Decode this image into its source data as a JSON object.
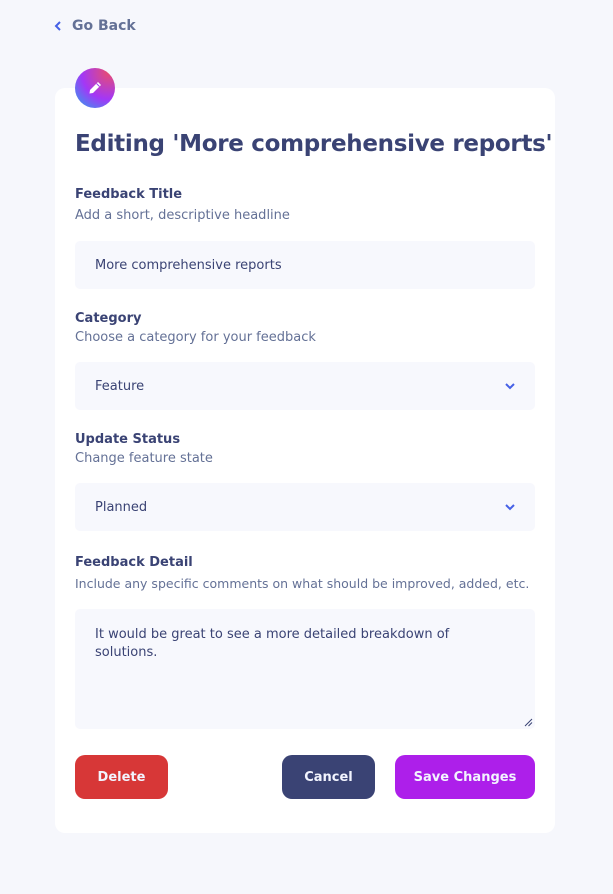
{
  "nav": {
    "go_back_label": "Go Back"
  },
  "page": {
    "title": "Editing 'More comprehensive reports'"
  },
  "form": {
    "feedback_title": {
      "label": "Feedback Title",
      "hint": "Add a short, descriptive headline",
      "value": "More comprehensive reports"
    },
    "category": {
      "label": "Category",
      "hint": "Choose a category for your feedback",
      "value": "Feature"
    },
    "status": {
      "label": "Update Status",
      "hint": "Change feature state",
      "value": "Planned"
    },
    "detail": {
      "label": "Feedback Detail",
      "hint": "Include any specific comments on what should be improved, added, etc.",
      "value": "It would be great to see a more detailed breakdown of solutions."
    }
  },
  "actions": {
    "delete_label": "Delete",
    "cancel_label": "Cancel",
    "save_label": "Save Changes"
  },
  "colors": {
    "delete": "#d73737",
    "cancel": "#3a4374",
    "save": "#ad1fea",
    "accent": "#4661e6"
  },
  "icons": {
    "back": "chevron-left-icon",
    "badge": "pen-icon",
    "dropdown": "chevron-down-icon"
  }
}
